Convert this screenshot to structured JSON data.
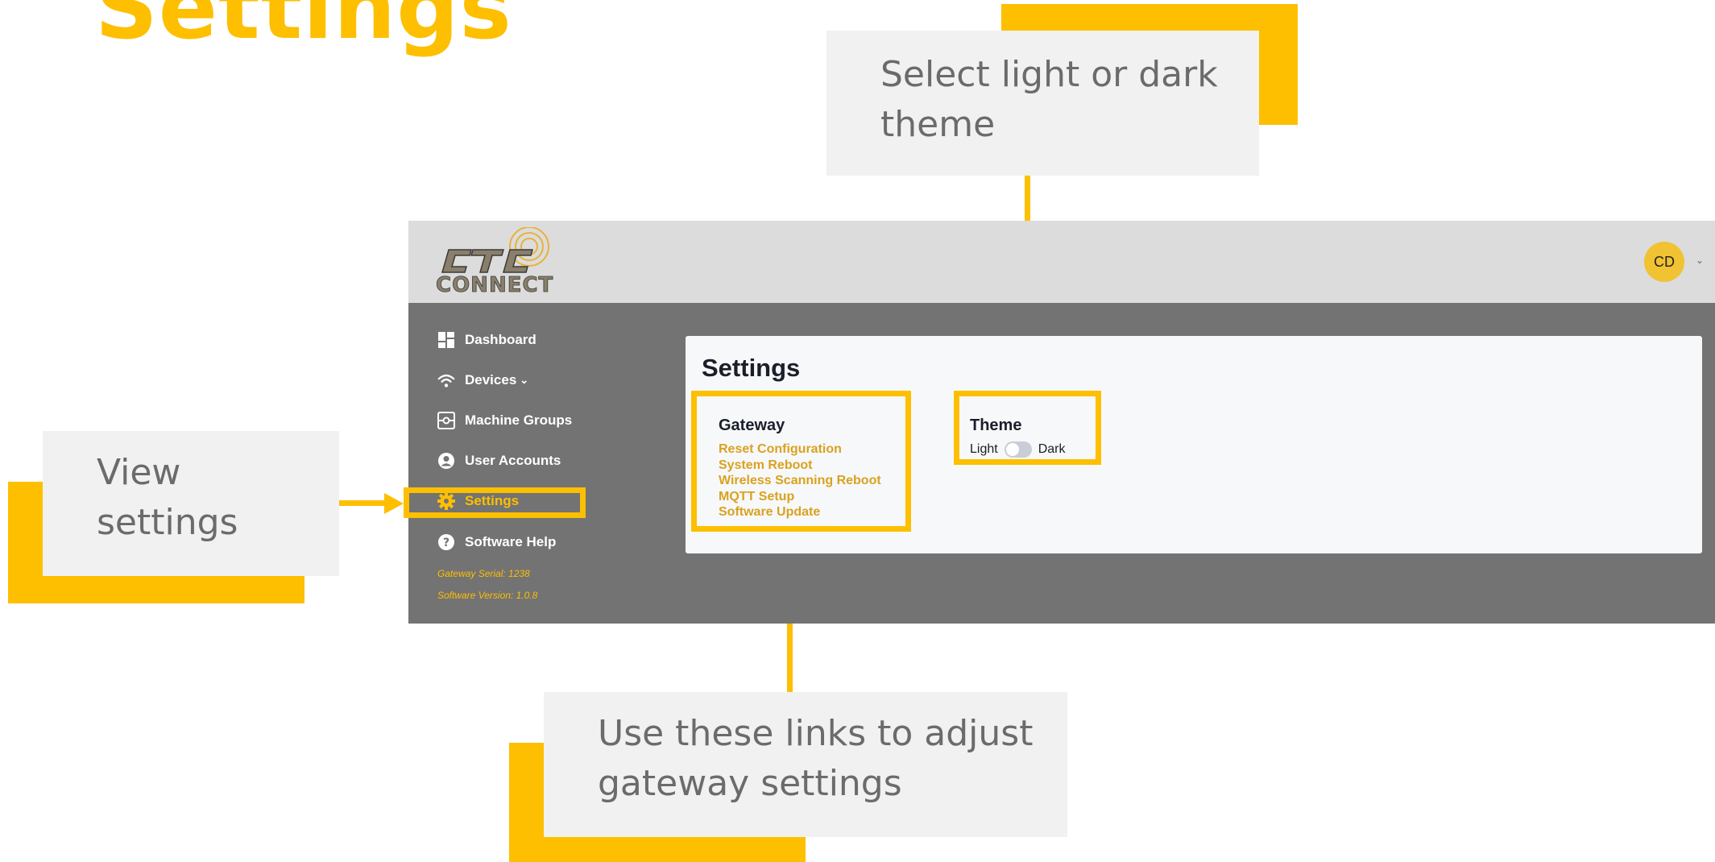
{
  "slide_title": "Settings",
  "colors": {
    "accent": "#fdbf00",
    "callout_bg": "#f1f1f1",
    "app_bg": "#737373",
    "header_bg": "#dcdcdc",
    "link": "#d9a21f"
  },
  "callouts": {
    "theme": "Select light or dark theme",
    "settings": "View settings",
    "gateway": "Use these links to adjust gateway settings"
  },
  "app": {
    "logo_text": "CTC CONNECT",
    "user_initials": "CD",
    "sidebar": {
      "items": [
        {
          "label": "Dashboard",
          "icon": "dashboard-icon"
        },
        {
          "label": "Devices",
          "icon": "wifi-icon",
          "caret": "chevron-down-icon"
        },
        {
          "label": "Machine Groups",
          "icon": "machine-groups-icon"
        },
        {
          "label": "User Accounts",
          "icon": "user-circle-icon"
        },
        {
          "label": "Settings",
          "icon": "gear-icon",
          "active": true
        },
        {
          "label": "Software Help",
          "icon": "help-circle-icon"
        }
      ],
      "gateway_serial": "Gateway Serial: 1238",
      "software_version": "Software Version: 1.0.8"
    },
    "settings_card": {
      "title": "Settings",
      "gateway": {
        "heading": "Gateway",
        "links": [
          "Reset Configuration",
          "System Reboot",
          "Wireless Scanning Reboot",
          "MQTT Setup",
          "Software Update"
        ]
      },
      "theme": {
        "heading": "Theme",
        "light_label": "Light",
        "dark_label": "Dark",
        "dark_enabled": false
      }
    }
  }
}
